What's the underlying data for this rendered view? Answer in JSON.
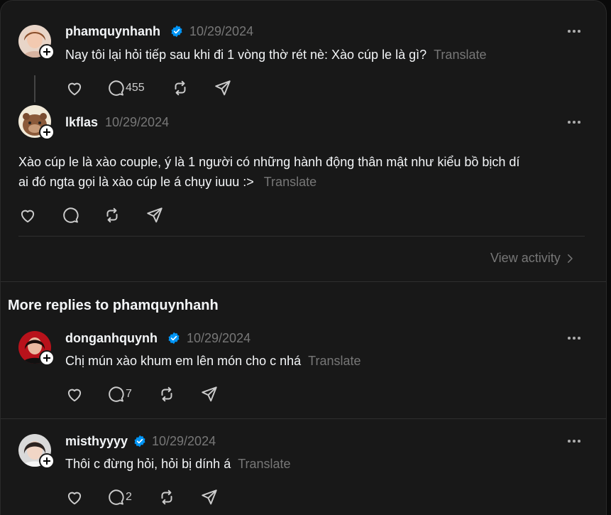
{
  "root_post": {
    "username": "phamquynhanh",
    "date": "10/29/2024",
    "text": "Nay tôi lại hỏi tiếp sau khi đi 1 vòng thờ rét nè: Xào cúp le là gì?",
    "translate": "Translate",
    "reply_count": "455"
  },
  "reply_main": {
    "username": "lkflas",
    "date": "10/29/2024",
    "text_line1": "Xào cúp le là xào couple, ý là 1 người có những hành động thân mật như kiểu bồ bịch dí",
    "text_line2": "ai đó ngta gọi là xào cúp le á chụy iuuu :>",
    "translate": "Translate"
  },
  "view_activity": "View activity",
  "more_replies_title": "More replies to phamquynhanh",
  "replies": [
    {
      "username": "donganhquynh",
      "date": "10/29/2024",
      "text": "Chị mún xào khum em lên món cho c nhá",
      "translate": "Translate",
      "reply_count": "7"
    },
    {
      "username": "misthyyyy",
      "date": "10/29/2024",
      "text": "Thôi c đừng hỏi, hỏi bị dính á",
      "translate": "Translate",
      "reply_count": "2"
    }
  ],
  "icons": {
    "like": "heart-icon",
    "comment": "comment-icon",
    "repost": "repost-icon",
    "share": "send-icon",
    "verified": "verified-badge-icon",
    "more": "more-options-icon"
  },
  "colors": {
    "background": "#181818",
    "verified": "#0095f6",
    "muted": "#777777"
  }
}
